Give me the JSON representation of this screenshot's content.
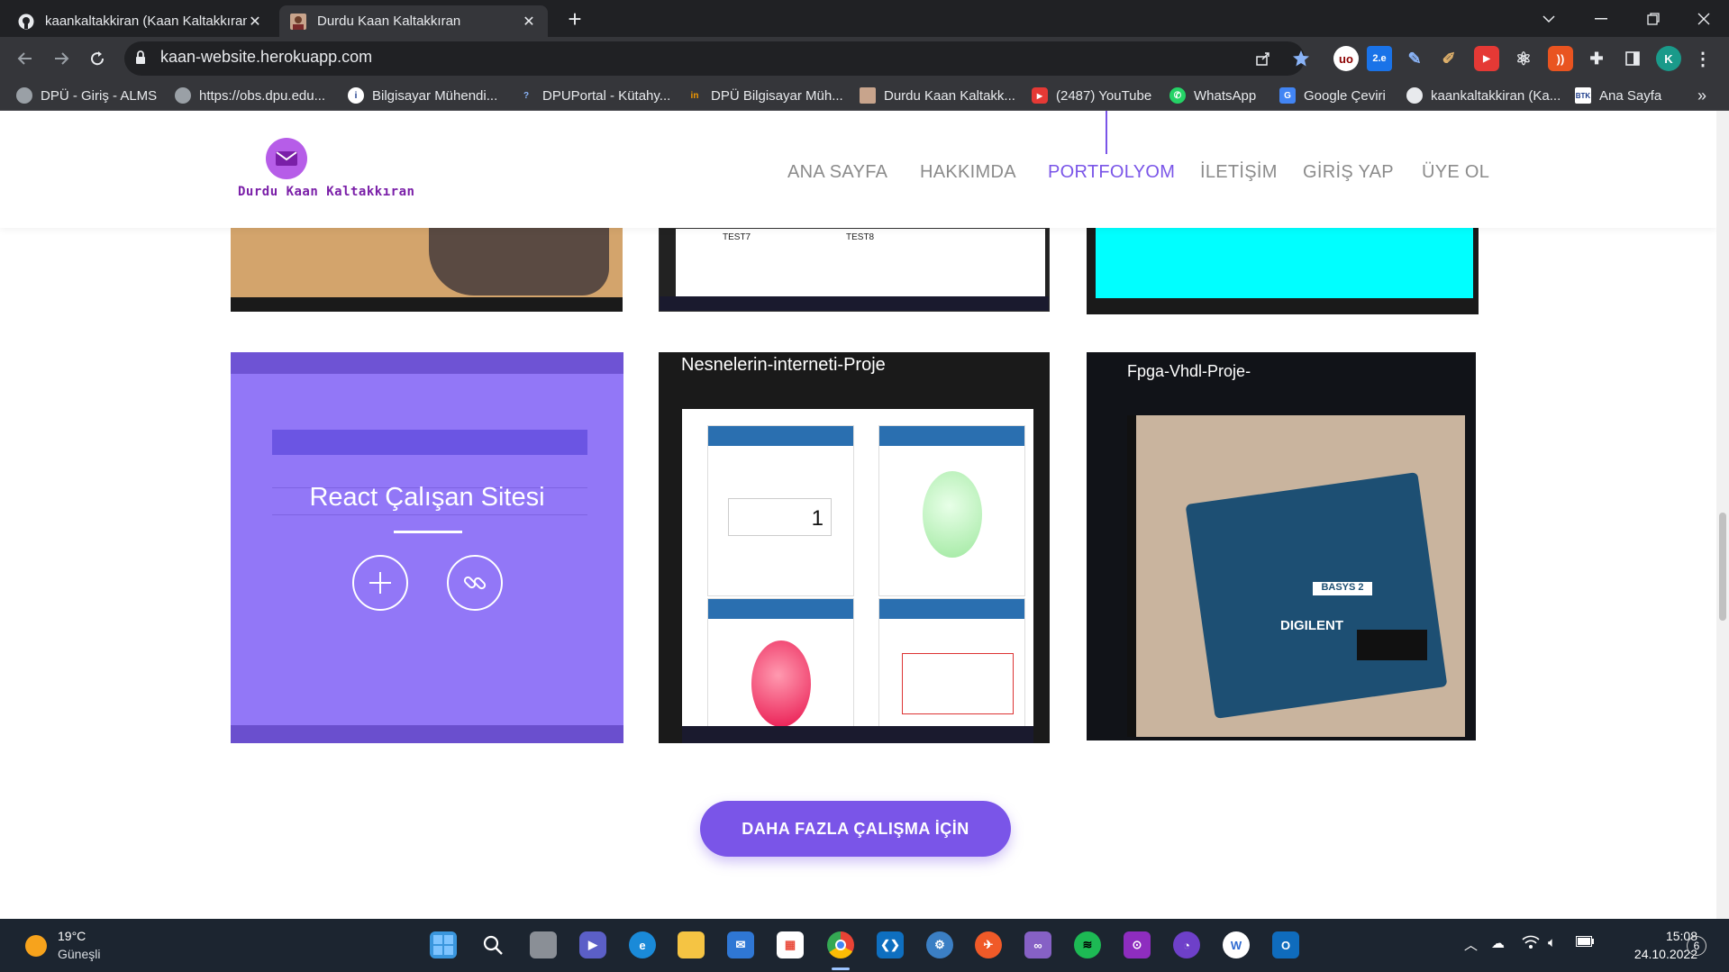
{
  "browser": {
    "tabs": [
      {
        "title": "kaankaltakkiran (Kaan Kaltakkıran)",
        "active": false
      },
      {
        "title": "Durdu Kaan Kaltakkıran",
        "active": true
      }
    ],
    "new_tab_symbol": "+",
    "close_symbol": "✕",
    "url": "kaan-website.herokuapp.com",
    "profile_initial": "K",
    "bookmarks": [
      {
        "label": "DPÜ - Giriş - ALMS",
        "icon": "globe-icon"
      },
      {
        "label": "https://obs.dpu.edu...",
        "icon": "globe-icon"
      },
      {
        "label": "Bilgisayar Mühendi...",
        "icon": "dpu-icon"
      },
      {
        "label": "DPUPortal - Kütahy...",
        "icon": "dpu-portal-icon"
      },
      {
        "label": "DPÜ Bilgisayar Müh...",
        "icon": "dpu-icon"
      },
      {
        "label": "Durdu Kaan Kaltakk...",
        "icon": "avatar-icon"
      },
      {
        "label": "(2487) YouTube",
        "icon": "youtube-icon"
      },
      {
        "label": "WhatsApp",
        "icon": "whatsapp-icon"
      },
      {
        "label": "Google Çeviri",
        "icon": "translate-icon"
      },
      {
        "label": "kaankaltakkiran (Ka...",
        "icon": "github-icon"
      },
      {
        "label": "Ana Sayfa",
        "icon": "btk-icon"
      }
    ],
    "bookmarks_overflow": "»"
  },
  "site": {
    "logo_text": "Durdu Kaan Kaltakkıran",
    "nav": [
      {
        "label": "ANA SAYFA",
        "active": false
      },
      {
        "label": "HAKKIMDA",
        "active": false
      },
      {
        "label": "PORTFOLYOM",
        "active": true
      },
      {
        "label": "İLETİŞİM",
        "active": false
      },
      {
        "label": "GİRİŞ YAP",
        "active": false
      },
      {
        "label": "ÜYE OL",
        "active": false
      }
    ],
    "portfolio": {
      "top_row_labels": [
        "TEST7",
        "TEST8"
      ],
      "cards": [
        {
          "title": "React Çalışan Sitesi",
          "hovered": true
        },
        {
          "title": "Nesnelerin-interneti-Proje",
          "hovered": false,
          "widget_value": "1"
        },
        {
          "title": "Fpga-Vhdl-Proje-",
          "hovered": false,
          "board_label": "BASYS 2",
          "brand": "DIGILENT"
        }
      ],
      "more_button": "DAHA FAZLA ÇALIŞMA İÇİN"
    },
    "colors": {
      "accent": "#7a55e8",
      "logo": "#b65de8"
    }
  },
  "taskbar": {
    "weather_temp": "19°C",
    "weather_desc": "Güneşli",
    "time": "15:08",
    "date": "24.10.2022",
    "notification_count": "6"
  }
}
